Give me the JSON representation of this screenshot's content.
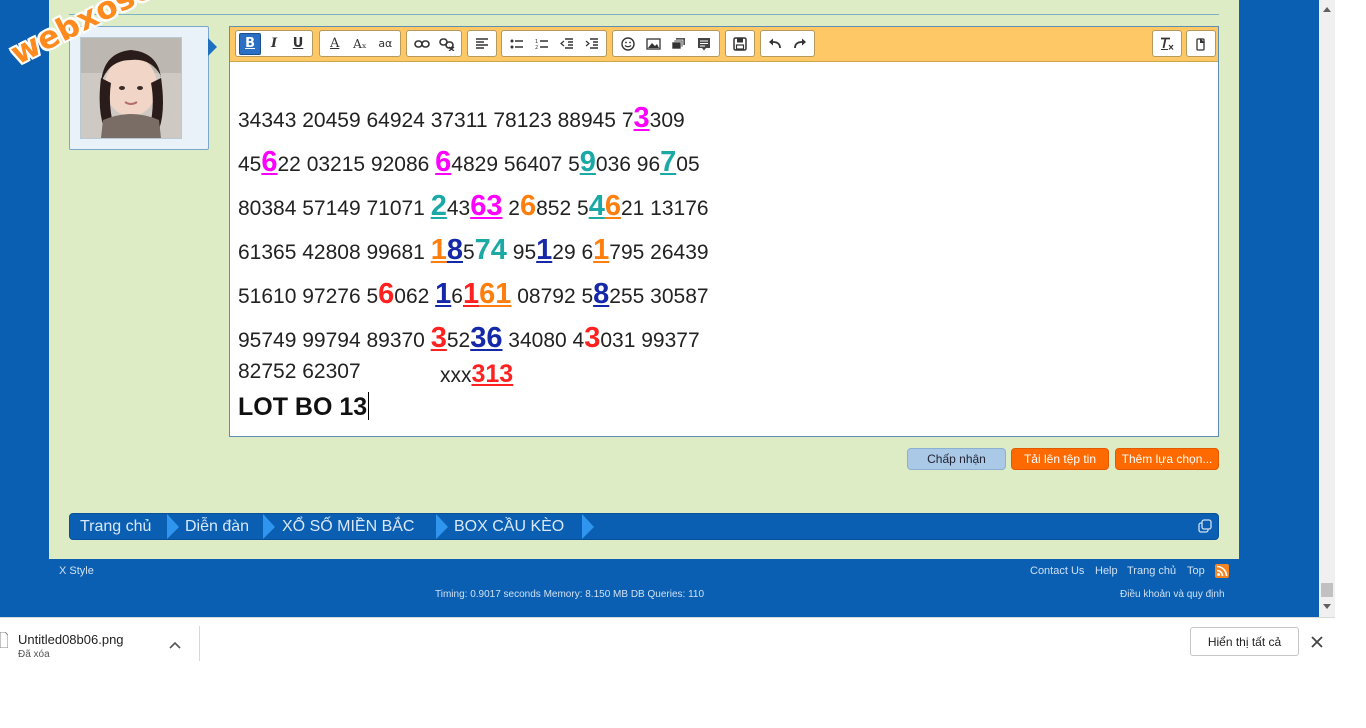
{
  "watermark": "webxoso.net",
  "editor": {
    "toolbar": {
      "bold": "B",
      "italic": "I",
      "underline": "U",
      "font_color": "A",
      "font_size": "Aₓ",
      "font_family": "aα"
    },
    "lines": [
      [
        "34343 20459 64924 37311 78123 88945 7",
        "3",
        "309"
      ],
      [
        "45",
        "6",
        "22 03215 92086 ",
        "6",
        "4829 56407 5",
        "9",
        "036 96",
        "7",
        "05"
      ],
      [
        "80384 57149 71071 ",
        "2",
        "43",
        "63",
        " 2",
        "6",
        "852 5",
        "4",
        "6",
        "21 13176"
      ],
      [
        "61365 42808 99681 ",
        "1",
        "8",
        "5",
        "74",
        " 95",
        "1",
        "29 6",
        "1",
        "795 26439"
      ],
      [
        "51610 97276 5",
        "6",
        "062 ",
        "1",
        "6",
        "1",
        "61",
        " 08792 5",
        "8",
        "255 30587"
      ],
      [
        "95749 99794 89370 ",
        "3",
        "52",
        "36",
        " 34080 4",
        "3",
        "031 99377"
      ],
      [
        "82752 62307",
        "xxx",
        "313"
      ],
      [
        "LOT BO 13"
      ]
    ]
  },
  "actions": {
    "accept": "Chấp nhận",
    "upload": "Tải lên tệp tin",
    "more": "Thêm lựa chọn..."
  },
  "breadcrumb": [
    "Trang chủ",
    "Diễn đàn",
    "XỔ SỐ MIỀN BẮC",
    "BOX CẦU KÈO"
  ],
  "footer": {
    "style": "X Style",
    "links": [
      "Contact Us",
      "Help",
      "Trang chủ",
      "Top"
    ],
    "timing": "Timing: 0.9017 seconds Memory: 8.150 MB DB Queries: 110",
    "terms": "Điều khoản và quy định"
  },
  "download": {
    "filename": "Untitled08b06.png",
    "status": "Đã xóa",
    "show_all": "Hiển thị tất cả"
  },
  "colors": {
    "magenta": "#ff00ff",
    "teal": "#1aa9a5",
    "orange": "#ff7f0e",
    "navy": "#1428a8",
    "red": "#ff2020",
    "page_blue": "#0a5fb3",
    "panel": "#deecc6"
  }
}
